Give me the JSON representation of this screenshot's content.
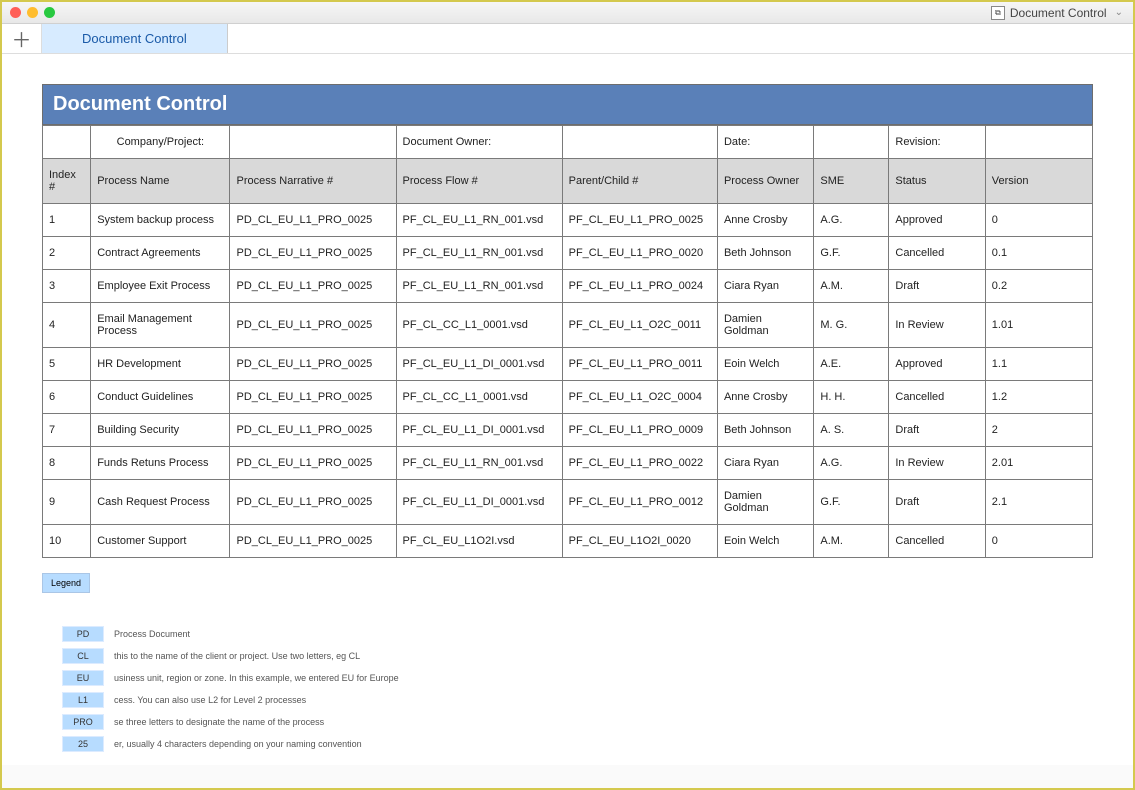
{
  "window": {
    "title": "Document Control"
  },
  "tab": {
    "label": "Document Control"
  },
  "page": {
    "title": "Document Control"
  },
  "meta": {
    "company": "Company/Project:",
    "docowner": "Document Owner:",
    "date": "Date:",
    "revision": "Revision:"
  },
  "headers": {
    "idx": "Index #",
    "name": "Process Name",
    "narr": "Process Narrative #",
    "flow": "Process Flow #",
    "pc": "Parent/Child #",
    "owner": "Process Owner",
    "sme": "SME",
    "status": "Status",
    "ver": "Version"
  },
  "rows": [
    {
      "idx": "1",
      "name": "System backup process",
      "narr": "PD_CL_EU_L1_PRO_0025",
      "flow": "PF_CL_EU_L1_RN_001.vsd",
      "pc": "PF_CL_EU_L1_PRO_0025",
      "owner": "Anne Crosby",
      "sme": "A.G.",
      "status": "Approved",
      "ver": "0"
    },
    {
      "idx": "2",
      "name": "Contract Agreements",
      "narr": "PD_CL_EU_L1_PRO_0025",
      "flow": "PF_CL_EU_L1_RN_001.vsd",
      "pc": "PF_CL_EU_L1_PRO_0020",
      "owner": "Beth Johnson",
      "sme": "G.F.",
      "status": "Cancelled",
      "ver": "0.1"
    },
    {
      "idx": "3",
      "name": "Employee Exit Process",
      "narr": "PD_CL_EU_L1_PRO_0025",
      "flow": "PF_CL_EU_L1_RN_001.vsd",
      "pc": "PF_CL_EU_L1_PRO_0024",
      "owner": "Ciara Ryan",
      "sme": "A.M.",
      "status": "Draft",
      "ver": "0.2"
    },
    {
      "idx": "4",
      "name": "Email Management Process",
      "narr": "PD_CL_EU_L1_PRO_0025",
      "flow": "PF_CL_CC_L1_0001.vsd",
      "pc": "PF_CL_EU_L1_O2C_0011",
      "owner": "Damien Goldman",
      "sme": "M. G.",
      "status": "In Review",
      "ver": "1.01"
    },
    {
      "idx": "5",
      "name": "HR Development",
      "narr": "PD_CL_EU_L1_PRO_0025",
      "flow": "PF_CL_EU_L1_DI_0001.vsd",
      "pc": "PF_CL_EU_L1_PRO_0011",
      "owner": "Eoin Welch",
      "sme": "A.E.",
      "status": "Approved",
      "ver": "1.1"
    },
    {
      "idx": "6",
      "name": "Conduct Guidelines",
      "narr": "PD_CL_EU_L1_PRO_0025",
      "flow": "PF_CL_CC_L1_0001.vsd",
      "pc": "PF_CL_EU_L1_O2C_0004",
      "owner": "Anne Crosby",
      "sme": "H. H.",
      "status": "Cancelled",
      "ver": "1.2"
    },
    {
      "idx": "7",
      "name": "Building Security",
      "narr": "PD_CL_EU_L1_PRO_0025",
      "flow": "PF_CL_EU_L1_DI_0001.vsd",
      "pc": "PF_CL_EU_L1_PRO_0009",
      "owner": "Beth Johnson",
      "sme": "A. S.",
      "status": "Draft",
      "ver": "2"
    },
    {
      "idx": "8",
      "name": "Funds Retuns Process",
      "narr": "PD_CL_EU_L1_PRO_0025",
      "flow": "PF_CL_EU_L1_RN_001.vsd",
      "pc": "PF_CL_EU_L1_PRO_0022",
      "owner": "Ciara Ryan",
      "sme": "A.G.",
      "status": "In Review",
      "ver": "2.01"
    },
    {
      "idx": "9",
      "name": "Cash Request Process",
      "narr": "PD_CL_EU_L1_PRO_0025",
      "flow": "PF_CL_EU_L1_DI_0001.vsd",
      "pc": "PF_CL_EU_L1_PRO_0012",
      "owner": "Damien Goldman",
      "sme": "G.F.",
      "status": "Draft",
      "ver": "2.1"
    },
    {
      "idx": "10",
      "name": "Customer Support",
      "narr": "PD_CL_EU_L1_PRO_0025",
      "flow": "PF_CL_EU_L1O2I.vsd",
      "pc": "PF_CL_EU_L1O2I_0020",
      "owner": "Eoin Welch",
      "sme": "A.M.",
      "status": "Cancelled",
      "ver": "0"
    }
  ],
  "legend": {
    "label": "Legend",
    "items": [
      {
        "key": "PD",
        "desc": "Process Document"
      },
      {
        "key": "CL",
        "desc": "this to the name of the client or project. Use two letters, eg CL"
      },
      {
        "key": "EU",
        "desc": "usiness unit, region or zone. In this example, we entered EU for Europe"
      },
      {
        "key": "L1",
        "desc": "cess. You can also use L2 for Level 2 processes"
      },
      {
        "key": "PRO",
        "desc": "se three letters to designate the name of the process"
      },
      {
        "key": "25",
        "desc": "er, usually 4 characters depending on your naming convention"
      }
    ]
  }
}
